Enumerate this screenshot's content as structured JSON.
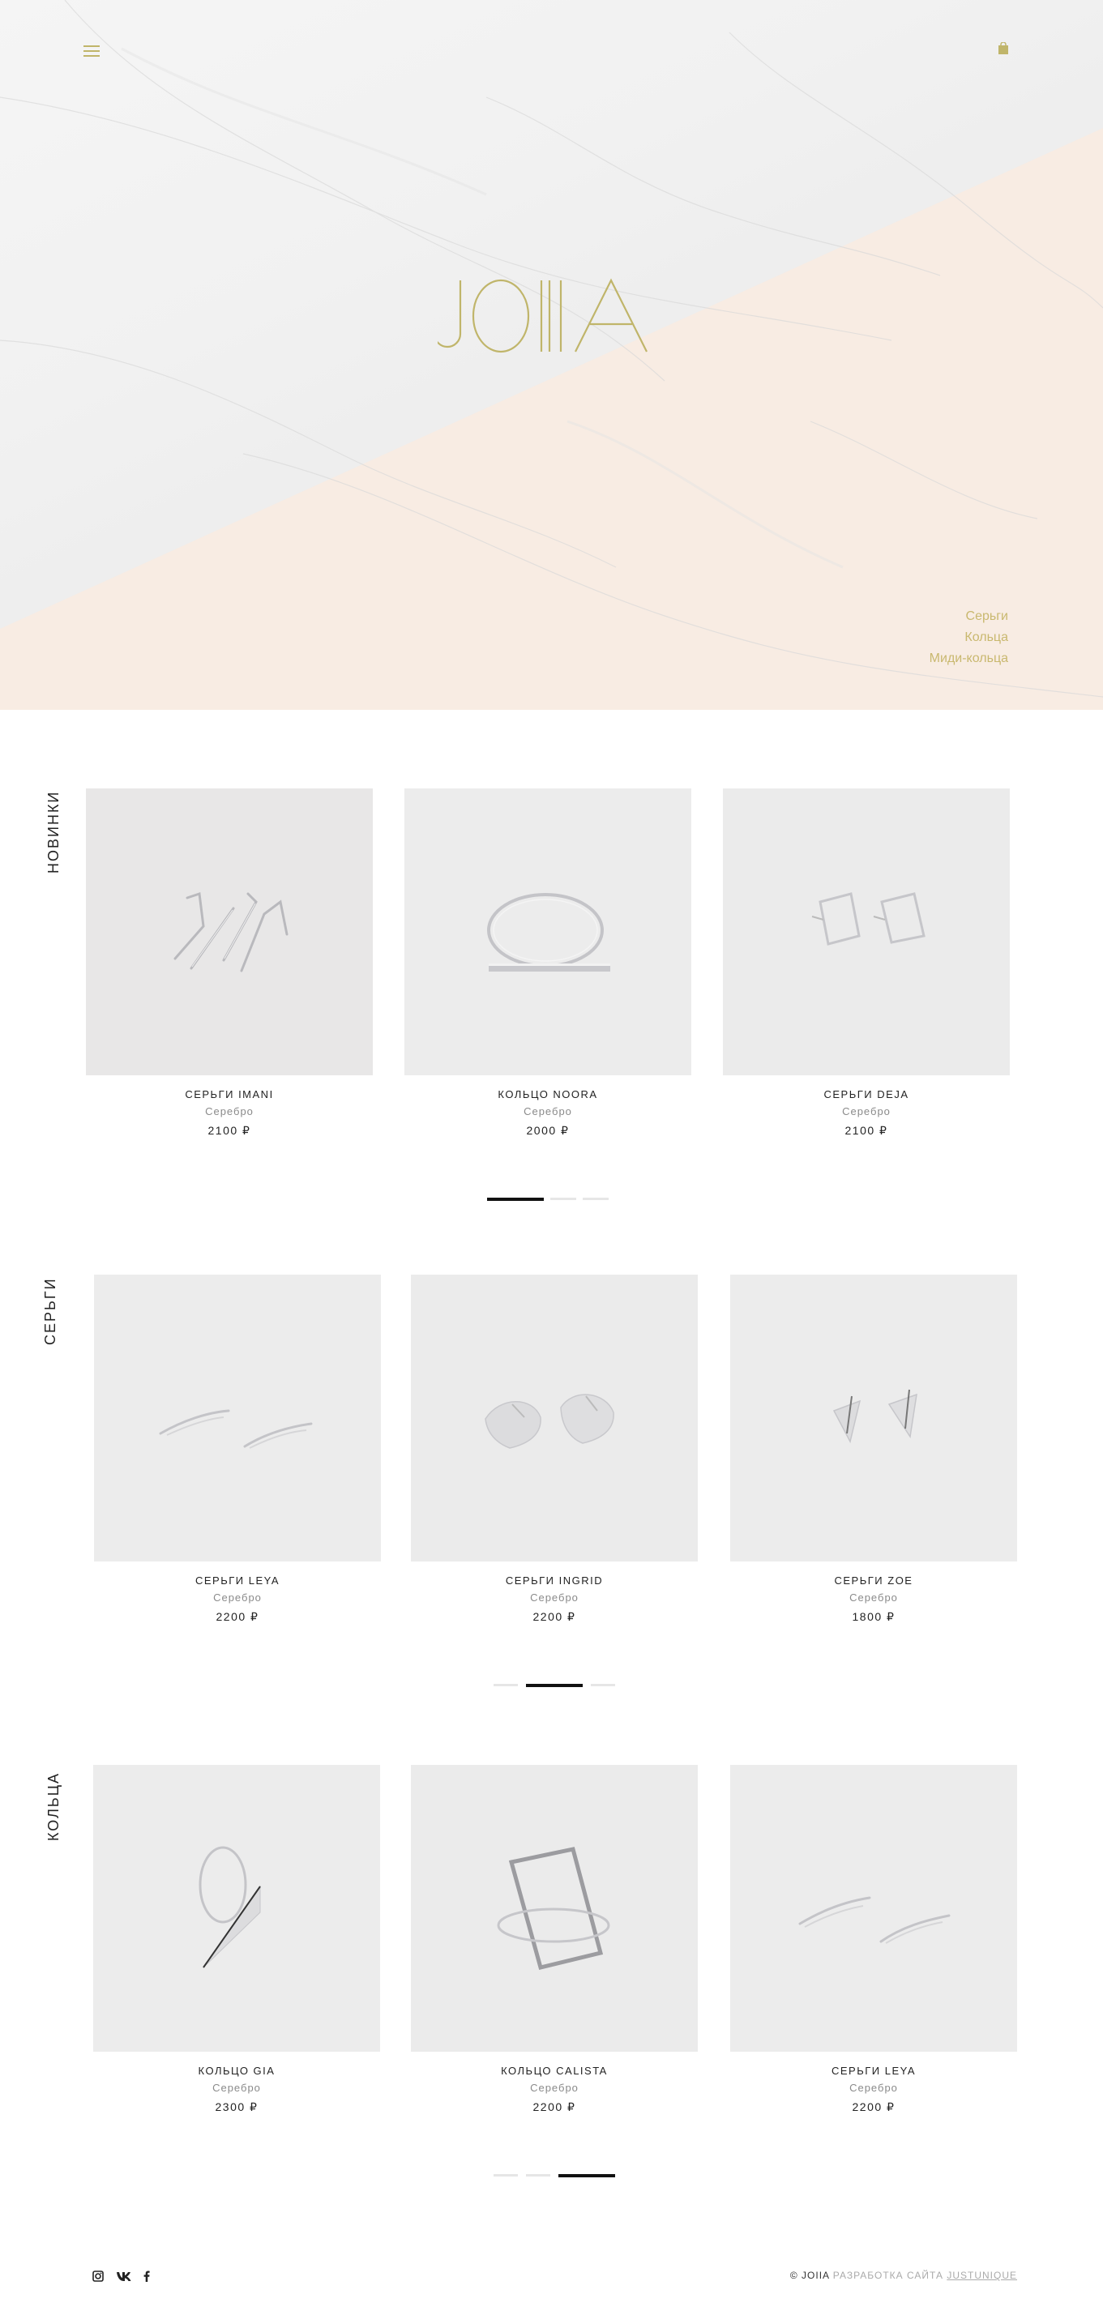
{
  "brand": {
    "logo_text": "JOIIA",
    "accent_color": "#c0b56a"
  },
  "header": {
    "menu_icon": "hamburger-icon",
    "cart_icon": "bag-icon"
  },
  "hero": {
    "links": [
      "Серьги",
      "Кольца",
      "Миди-кольца"
    ]
  },
  "sections": [
    {
      "title": "НОВИНКИ",
      "products": [
        {
          "name": "СЕРЬГИ IMANI",
          "material": "Серебро",
          "price": "2100 ₽"
        },
        {
          "name": "КОЛЬЦО NOORA",
          "material": "Серебро",
          "price": "2000 ₽"
        },
        {
          "name": "СЕРЬГИ DEJA",
          "material": "Серебро",
          "price": "2100 ₽"
        }
      ],
      "active_page": 1,
      "pages": 3
    },
    {
      "title": "СЕРЬГИ",
      "products": [
        {
          "name": "СЕРЬГИ LEYA",
          "material": "Серебро",
          "price": "2200 ₽"
        },
        {
          "name": "СЕРЬГИ INGRID",
          "material": "Серебро",
          "price": "2200 ₽"
        },
        {
          "name": "СЕРЬГИ ZOE",
          "material": "Серебро",
          "price": "1800 ₽"
        }
      ],
      "active_page": 2,
      "pages": 3
    },
    {
      "title": "КОЛЬЦА",
      "products": [
        {
          "name": "КОЛЬЦО GIA",
          "material": "Серебро",
          "price": "2300 ₽"
        },
        {
          "name": "КОЛЬЦО CALISTA",
          "material": "Серебро",
          "price": "2200 ₽"
        },
        {
          "name": "СЕРЬГИ LEYA",
          "material": "Серебро",
          "price": "2200 ₽"
        }
      ],
      "active_page": 3,
      "pages": 3
    }
  ],
  "footer": {
    "social_icons": [
      "instagram-icon",
      "vk-icon",
      "facebook-icon"
    ],
    "copyright": "© JOIIA",
    "developer_label": "РАЗРАБОТКА САЙТА",
    "developer_link": "JUSTUNIQUE"
  }
}
